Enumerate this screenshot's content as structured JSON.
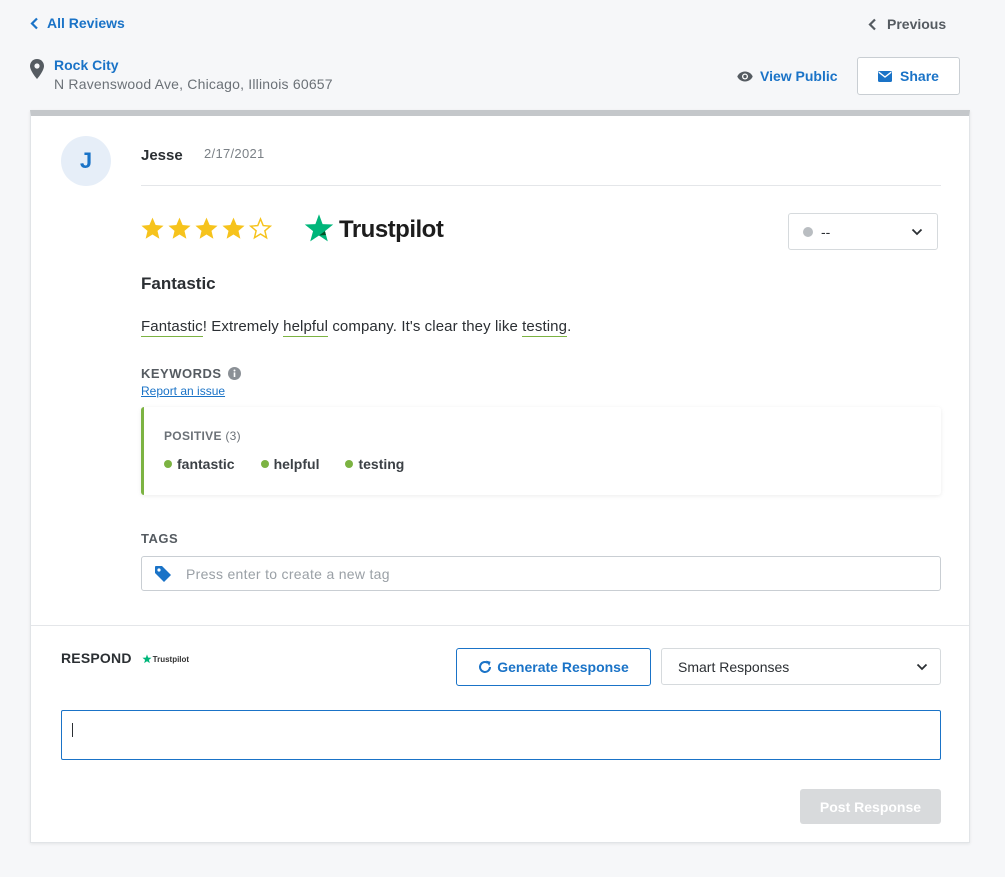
{
  "nav": {
    "back_label": "All Reviews",
    "previous_label": "Previous"
  },
  "location": {
    "name": "Rock City",
    "address": "N Ravenswood Ave, Chicago, Illinois 60657"
  },
  "header_actions": {
    "view_public_label": "View Public",
    "share_label": "Share"
  },
  "colors": {
    "accent": "#1a73c7",
    "star": "#f6c31c",
    "positive": "#7cb342",
    "trustpilot_green": "#00b67a"
  },
  "review": {
    "avatar_initial": "J",
    "author": "Jesse",
    "date": "2/17/2021",
    "rating": 4,
    "rating_max": 5,
    "source": "Trustpilot",
    "status_value": "--",
    "title": "Fantastic",
    "body": {
      "kw1": "Fantastic",
      "t1": "! Extremely ",
      "kw2": "helpful",
      "t2": " company. It's clear they like ",
      "kw3": "testing",
      "t3": "."
    }
  },
  "keywords": {
    "label": "KEYWORDS",
    "report_link": "Report an issue",
    "positive_label": "POSITIVE",
    "positive_count": "(3)",
    "positive": [
      "fantastic",
      "helpful",
      "testing"
    ]
  },
  "tags": {
    "label": "TAGS",
    "placeholder": "Press enter to create a new tag"
  },
  "respond": {
    "label": "RESPOND",
    "source_small": "Trustpilot",
    "generate_label": "Generate Response",
    "smart_responses_label": "Smart Responses",
    "response_value": "",
    "post_label": "Post Response"
  }
}
